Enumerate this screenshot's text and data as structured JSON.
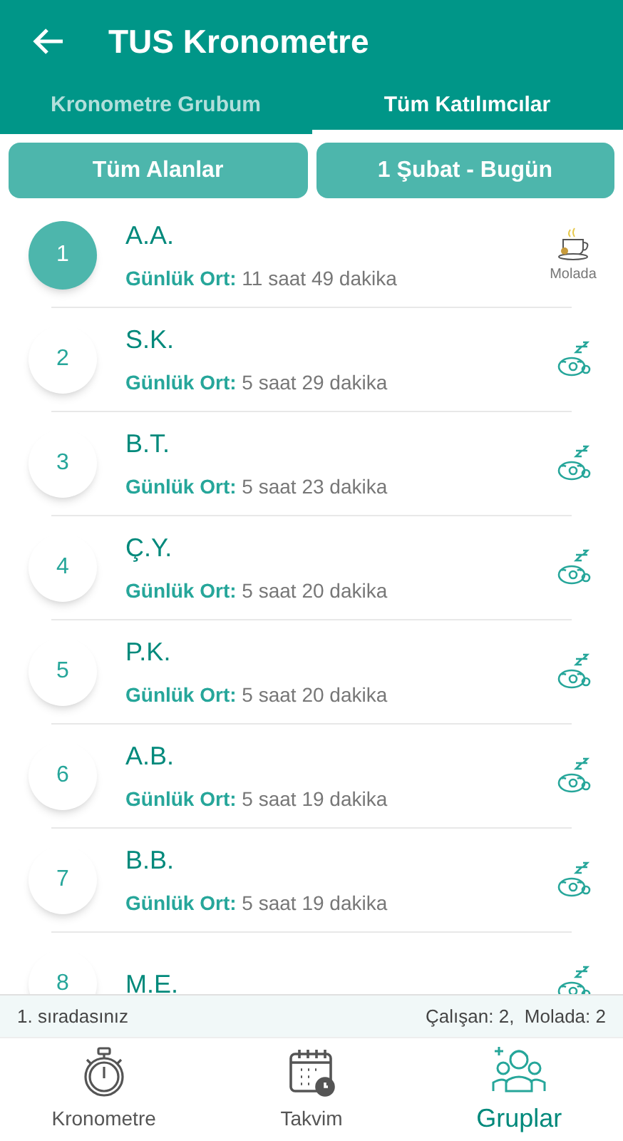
{
  "app_bar": {
    "title": "TUS Kronometre"
  },
  "tabs": [
    {
      "label": "Kronometre Grubum",
      "selected": false
    },
    {
      "label": "Tüm Katılımcılar",
      "selected": true
    }
  ],
  "filters": [
    "Tüm Alanlar",
    "1 Şubat - Bugün"
  ],
  "participants": [
    {
      "rank": "1",
      "name": "A.A.",
      "avg_label": "Günlük Ort:",
      "avg": "11 saat 49 dakika",
      "is_me": true,
      "kind": "break",
      "status_label": "Molada"
    },
    {
      "rank": "2",
      "name": "S.K.",
      "avg_label": "Günlük Ort:",
      "avg": "5 saat 29 dakika",
      "is_me": false,
      "kind": "sleeping"
    },
    {
      "rank": "3",
      "name": "B.T.",
      "avg_label": "Günlük Ort:",
      "avg": "5 saat 23 dakika",
      "is_me": false,
      "kind": "sleeping"
    },
    {
      "rank": "4",
      "name": "Ç.Y.",
      "avg_label": "Günlük Ort:",
      "avg": "5 saat 20 dakika",
      "is_me": false,
      "kind": "sleeping"
    },
    {
      "rank": "5",
      "name": "P.K.",
      "avg_label": "Günlük Ort:",
      "avg": "5 saat 20 dakika",
      "is_me": false,
      "kind": "sleeping"
    },
    {
      "rank": "6",
      "name": "A.B.",
      "avg_label": "Günlük Ort:",
      "avg": "5 saat 19 dakika",
      "is_me": false,
      "kind": "sleeping"
    },
    {
      "rank": "7",
      "name": "B.B.",
      "avg_label": "Günlük Ort:",
      "avg": "5 saat 19 dakika",
      "is_me": false,
      "kind": "sleeping"
    },
    {
      "rank": "8",
      "name": "M.E.",
      "is_me": false,
      "kind": "sleeping"
    }
  ],
  "status_bar": {
    "rank_text": "1. sıradasınız",
    "counts": "Çalışan: 2,  Molada: 2"
  },
  "bottom_nav": [
    {
      "label": "Kronometre",
      "kind": "stopwatch",
      "selected": false
    },
    {
      "label": "Takvim",
      "kind": "calendar",
      "selected": false
    },
    {
      "label": "Gruplar",
      "kind": "group",
      "selected": true
    }
  ]
}
